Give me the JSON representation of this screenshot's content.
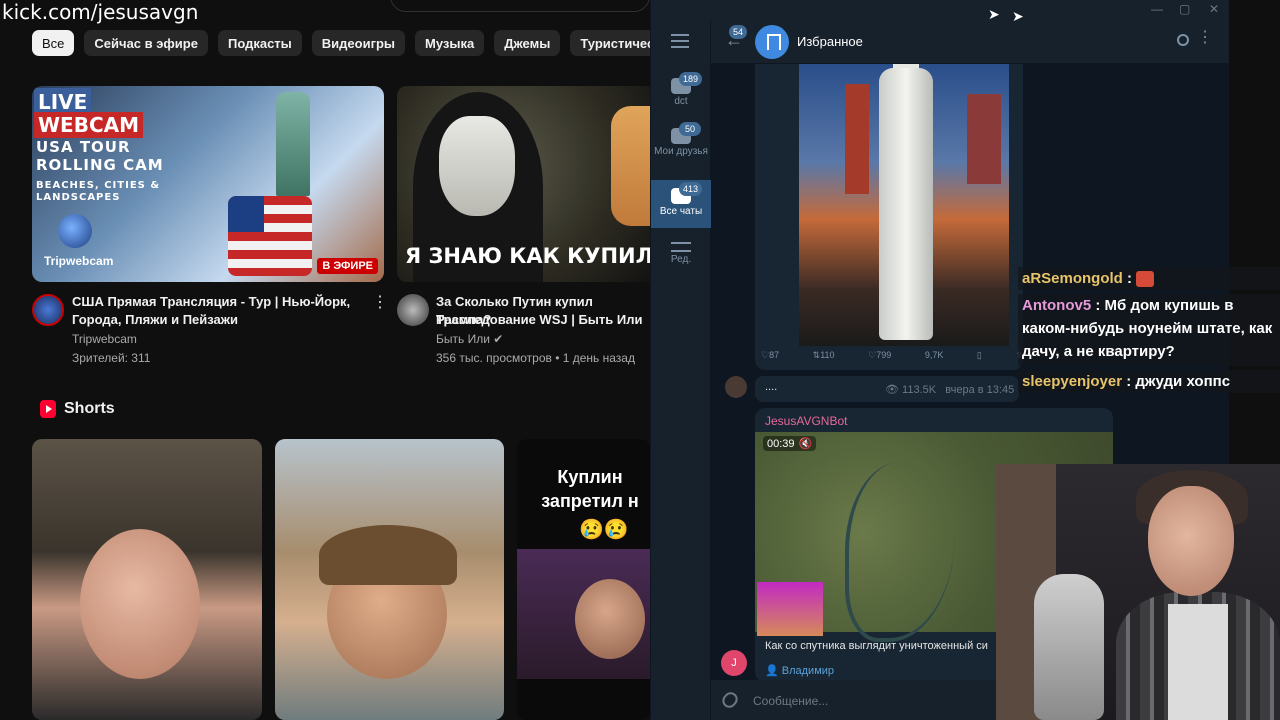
{
  "overlay": {
    "url": "kick.com/jesusavgn"
  },
  "youtube": {
    "chips": [
      "Все",
      "Сейчас в эфире",
      "Подкасты",
      "Видеоигры",
      "Музыка",
      "Джемы",
      "Туристические напра"
    ],
    "videos": [
      {
        "thumb": {
          "live": "LIVE",
          "webcam": "WEBCAM",
          "line1": "USA TOUR",
          "line2": "ROLLING CAM",
          "line3": "BEACHES, CITIES &",
          "line4": "LANDSCAPES",
          "brand": "Tripwebcam",
          "badge": "В ЭФИРЕ"
        },
        "title_1": "США Прямая Трансляция - Тур | Нью-Йорк,",
        "title_2": "Города, Пляжи и Пейзажи",
        "channel": "Tripwebcam",
        "stats": "Зрителей: 311"
      },
      {
        "thumb": {
          "caption": "Я ЗНАЮ КАК КУПИЛИ"
        },
        "title_1": "За Сколько Путин купил Трампа?",
        "title_2": "Расследование WSJ | Быть Или",
        "channel": "Быть Или ✔",
        "stats": "356 тыс. просмотров • 1 день назад"
      }
    ],
    "shorts": {
      "title": "Shorts",
      "third_text_1": "Куплин",
      "third_text_2": "запретил н",
      "third_emoji": "😢😢"
    }
  },
  "telegram": {
    "folders": [
      {
        "label": "dct",
        "badge": "189"
      },
      {
        "label": "Мои друзья",
        "badge": "50"
      },
      {
        "label": "Все чаты",
        "badge": "413"
      },
      {
        "label": "Ред.",
        "badge": ""
      }
    ],
    "header": {
      "back_badge": "54",
      "title": "Избранное"
    },
    "photo_stats": [
      "♡87",
      "⇅110",
      "♡799",
      "9,7K",
      "▯",
      "⇪"
    ],
    "message": {
      "text": "....",
      "views": "113.5K",
      "time": "вчера в 13:45"
    },
    "bot": {
      "name": "JesusAVGNBot",
      "duration": "00:39",
      "caption": "Как со спутника выглядит уничтоженный си",
      "sender": "👤 Владимир"
    },
    "j_avatar": "J",
    "input_placeholder": "Сообщение..."
  },
  "stream_chat": [
    {
      "nick": "aRSemongold",
      "sep": " : ",
      "text": ""
    },
    {
      "nick": "Antonov5",
      "sep": " : ",
      "text": "Мб дом купишь в каком-нибудь ноунейм штате, как дачу, а не квартиру?"
    },
    {
      "nick": "sleepyenjoyer",
      "sep": " : ",
      "text": "джуди хоппс"
    }
  ],
  "colors": {
    "yt_bg": "#0f0f0f",
    "tg_bg": "#17212b",
    "tg_chat_bg": "#0e1621",
    "accent": "#2b5278",
    "live_red": "#cc0000"
  }
}
